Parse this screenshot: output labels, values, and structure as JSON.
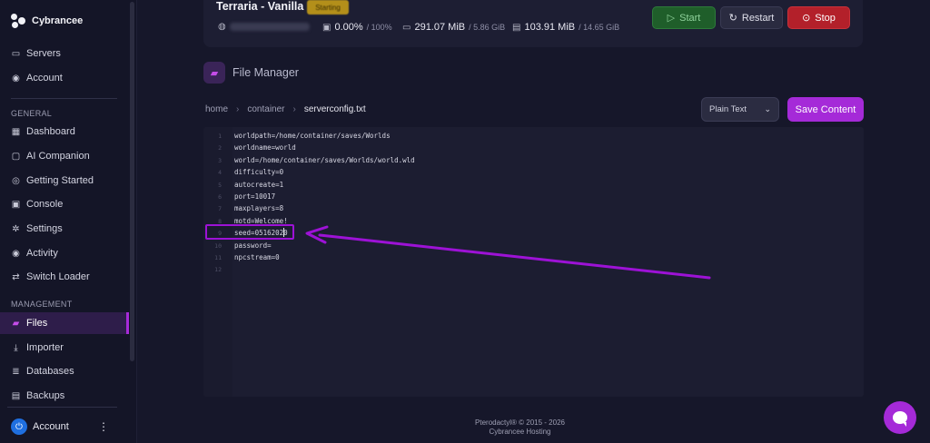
{
  "brand": {
    "name": "Cybrancee"
  },
  "nav": {
    "top": [
      {
        "label": "Servers",
        "icon": "server-icon"
      },
      {
        "label": "Account",
        "icon": "user-circle-icon"
      }
    ],
    "general_label": "GENERAL",
    "general": [
      {
        "label": "Dashboard",
        "icon": "grid-icon"
      },
      {
        "label": "AI Companion",
        "icon": "chat-icon"
      },
      {
        "label": "Getting Started",
        "icon": "globe-icon"
      },
      {
        "label": "Console",
        "icon": "terminal-icon"
      },
      {
        "label": "Settings",
        "icon": "gear-icon"
      },
      {
        "label": "Activity",
        "icon": "eye-icon"
      },
      {
        "label": "Switch Loader",
        "icon": "swap-icon"
      }
    ],
    "management_label": "MANAGEMENT",
    "management": [
      {
        "label": "Files",
        "icon": "folder-icon",
        "active": true
      },
      {
        "label": "Importer",
        "icon": "download-icon"
      },
      {
        "label": "Databases",
        "icon": "database-icon"
      },
      {
        "label": "Backups",
        "icon": "archive-icon"
      }
    ],
    "account_label": "Account"
  },
  "server": {
    "title": "Terraria - Vanilla",
    "status": "Starting",
    "cpu": "0.00%",
    "cpu_limit": "/ 100%",
    "memory": "291.07 MiB",
    "memory_limit": "/ 5.86 GiB",
    "disk": "103.91 MiB",
    "disk_limit": "/ 14.65 GiB",
    "buttons": {
      "start": "Start",
      "restart": "Restart",
      "stop": "Stop"
    }
  },
  "file_manager": {
    "title": "File Manager",
    "breadcrumb": [
      "home",
      "container",
      "serverconfig.txt"
    ],
    "mode": "Plain Text",
    "save_label": "Save Content",
    "lines": [
      "worldpath=/home/container/saves/Worlds",
      "worldname=world",
      "world=/home/container/saves/Worlds/world.wld",
      "difficulty=0",
      "autocreate=1",
      "port=10017",
      "maxplayers=8",
      "motd=Welcome!",
      "seed=05162020",
      "password=",
      "npcstream=0",
      ""
    ],
    "line_numbers": [
      "1",
      "2",
      "3",
      "4",
      "5",
      "6",
      "7",
      "8",
      "9",
      "10",
      "11",
      "12"
    ]
  },
  "footer": {
    "line1": "Pterodactyl® © 2015 - 2026",
    "line2": "Cybrancee Hosting"
  },
  "colors": {
    "accent": "#a52ad8",
    "annotation": "#9d12d6",
    "start": "#1f5e2a",
    "stop": "#b3202a",
    "status_badge": "#b38f1a"
  }
}
